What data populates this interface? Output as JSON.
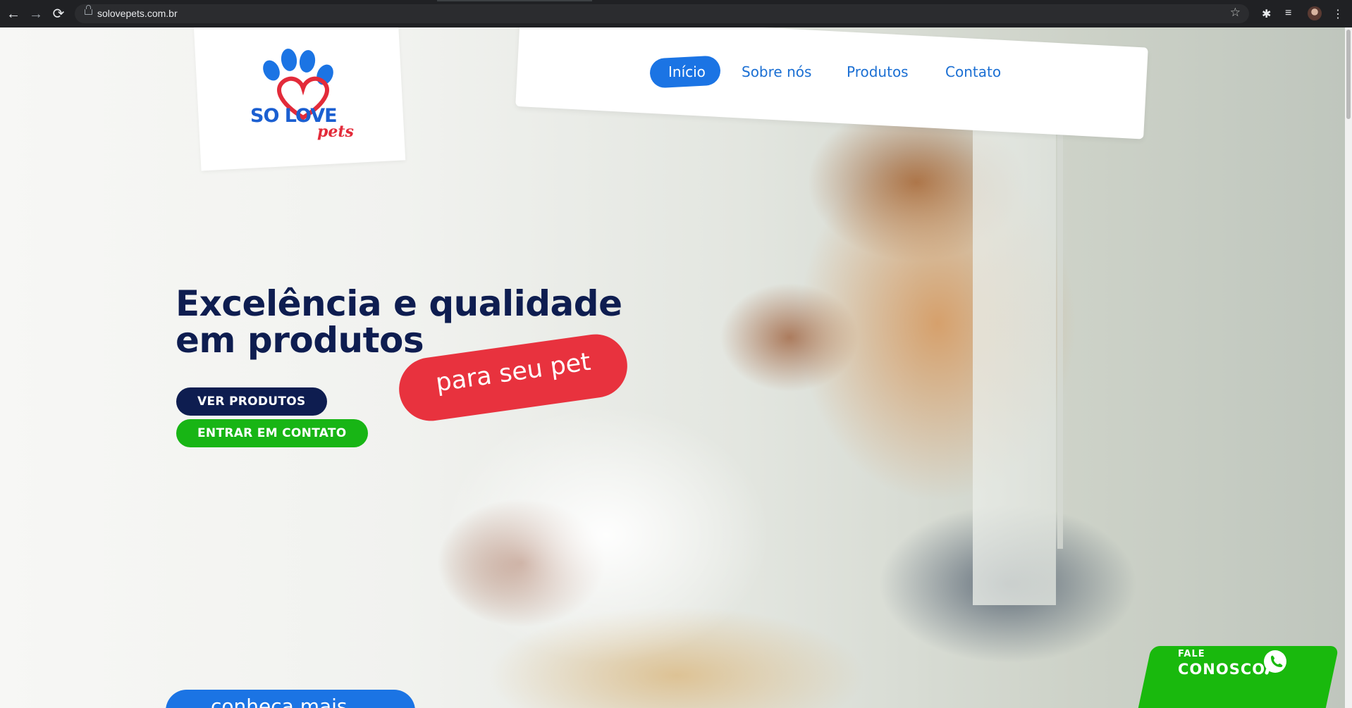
{
  "browser": {
    "url": "solovepets.com.br",
    "back_icon": "←",
    "forward_icon": "→",
    "reload_icon": "⟳",
    "star_icon": "☆",
    "extensions_icon": "✱",
    "media_icon": "≡",
    "menu_icon": "⋮"
  },
  "logo": {
    "text": "SO LOVE",
    "subtext": "pets"
  },
  "nav": {
    "items": [
      {
        "label": "Início",
        "active": true
      },
      {
        "label": "Sobre nós",
        "active": false
      },
      {
        "label": "Produtos",
        "active": false
      },
      {
        "label": "Contato",
        "active": false
      }
    ]
  },
  "hero": {
    "headline_line1": "Excelência e qualidade",
    "headline_line2": "em produtos",
    "badge": "para seu pet",
    "btn_products": "VER PRODUTOS",
    "btn_contact": "ENTRAR EM CONTATO",
    "more_button": "conheça mais",
    "more_arrow": "→"
  },
  "whatsapp": {
    "small": "FALE",
    "big": "CONOSCO"
  },
  "colors": {
    "brand_blue": "#1b74e4",
    "navy": "#0e1d50",
    "green": "#18b515",
    "red": "#e8323e"
  }
}
